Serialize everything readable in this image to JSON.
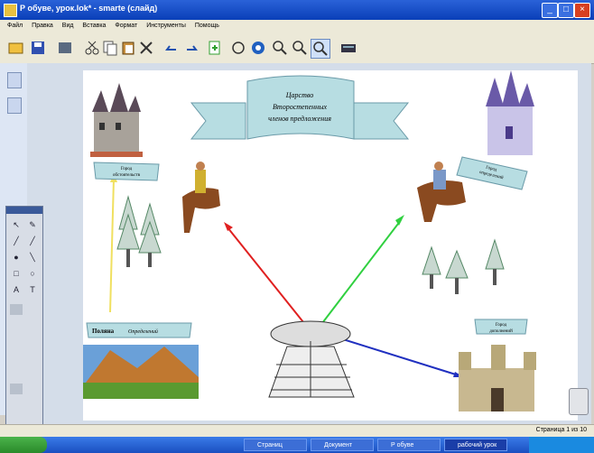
{
  "window": {
    "title": "Р обуве, урок.lok* - smarte (слайд)",
    "min_label": "_",
    "max_label": "□",
    "close_label": "×"
  },
  "menu": [
    "Файл",
    "Правка",
    "Вид",
    "Вставка",
    "Формат",
    "Инструменты",
    "Помощь"
  ],
  "page": {
    "banner": [
      "Царство",
      "Второстепенных",
      "членов предложения"
    ],
    "city_left_label": [
      "Город",
      "обстоятельств"
    ],
    "city_right_label": [
      "Город",
      "определений"
    ],
    "city_bottom_label": [
      "Город",
      "дополнений"
    ],
    "polyana_label": "Поляна",
    "polyana_sub": "Определений"
  },
  "status": {
    "page_count": "Страница 1 из 10"
  },
  "taskbar": {
    "tasks": [
      "Страниц",
      "Документ",
      "Р обуве",
      "рабочий урок"
    ]
  },
  "colors": {
    "arrow_red": "#e02020",
    "arrow_green": "#30d040",
    "arrow_blue": "#2030c0",
    "arrow_yellow": "#f0e060",
    "banner": "#b7dde2"
  }
}
